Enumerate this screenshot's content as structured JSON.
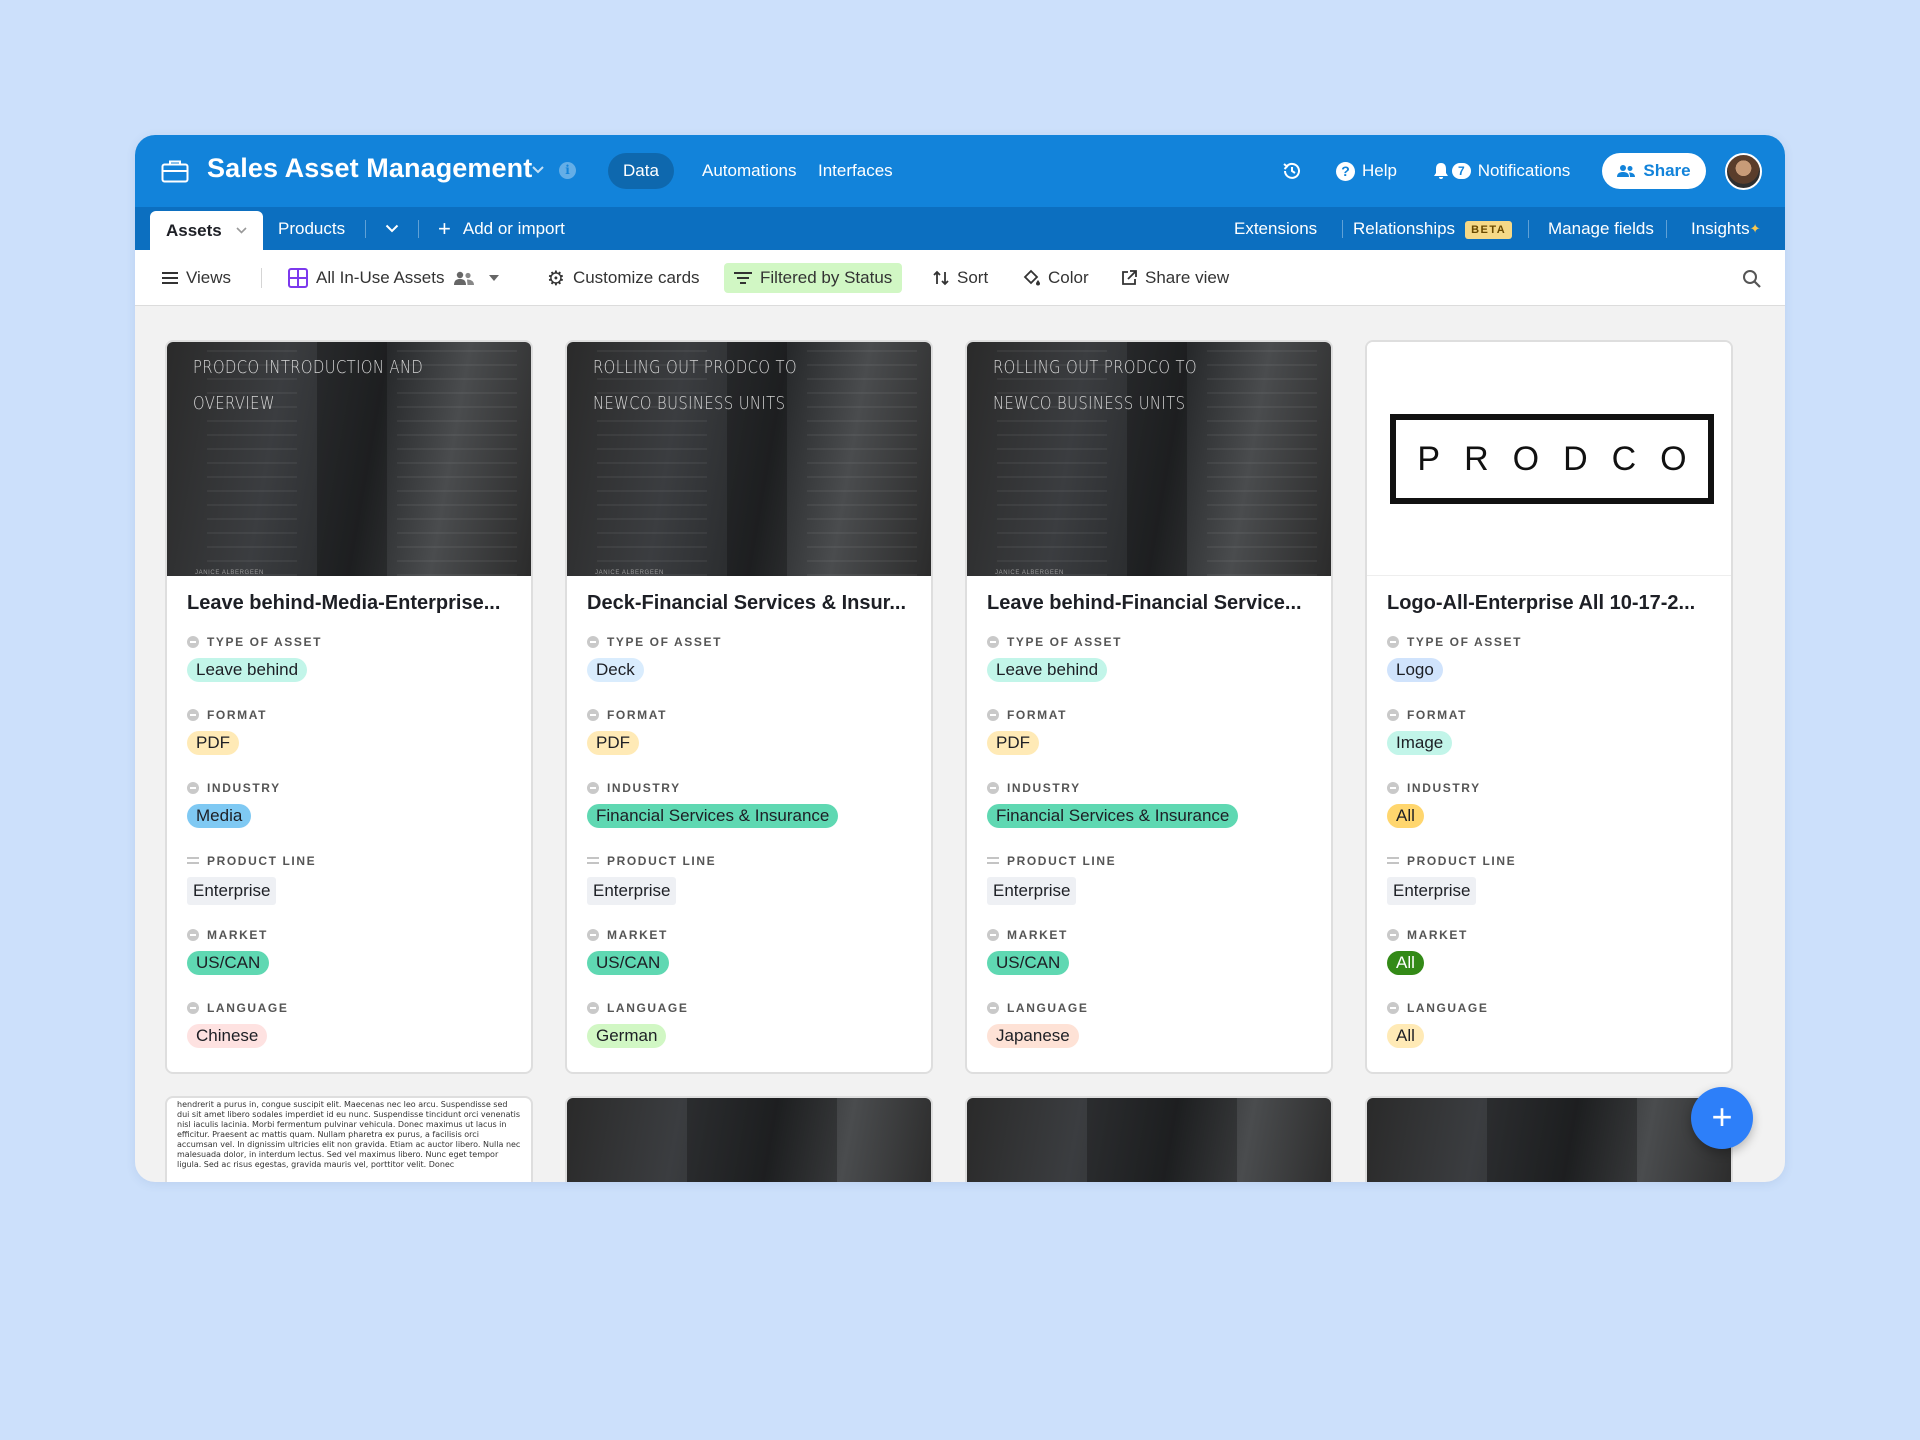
{
  "app": {
    "title": "Sales Asset Management"
  },
  "top_nav": {
    "tabs": [
      "Data",
      "Automations",
      "Interfaces"
    ],
    "active_tab": "Data"
  },
  "top_right": {
    "help": "Help",
    "notifications": "Notifications",
    "notification_count": "7",
    "share": "Share"
  },
  "table_tabs": {
    "assets": "Assets",
    "products": "Products",
    "add": "Add or import"
  },
  "table_right": {
    "extensions": "Extensions",
    "relationships": "Relationships",
    "beta": "BETA",
    "manage_fields": "Manage fields",
    "insights": "Insights"
  },
  "viewbar": {
    "views": "Views",
    "view_name": "All In-Use Assets",
    "customize": "Customize cards",
    "filter": "Filtered by Status",
    "sort": "Sort",
    "color": "Color",
    "share_view": "Share view"
  },
  "field_labels": {
    "type": "TYPE OF ASSET",
    "format": "FORMAT",
    "industry": "INDUSTRY",
    "product_line": "PRODUCT LINE",
    "market": "MARKET",
    "language": "LANGUAGE"
  },
  "cards": [
    {
      "slide": [
        "PRODCO INTRODUCTION AND",
        "OVERVIEW"
      ],
      "author": "JANICE ALBERGEEN",
      "title": "Leave behind-Media-Enterprise...",
      "type": "Leave behind",
      "format": "PDF",
      "industry": "Media",
      "product_line": "Enterprise",
      "market": "US/CAN",
      "language": "Chinese",
      "colors": {
        "type": "#c2f5e9",
        "format": "#ffeab6",
        "industry": "#7fc9f3",
        "market": "#5fd8b2",
        "language": "#fee2e1"
      }
    },
    {
      "slide": [
        "ROLLING OUT PRODCO TO",
        "NEWCO BUSINESS UNITS"
      ],
      "author": "JANICE ALBERGEEN",
      "title": "Deck-Financial Services & Insur...",
      "type": "Deck",
      "format": "PDF",
      "industry": "Financial Services & Insurance",
      "product_line": "Enterprise",
      "market": "US/CAN",
      "language": "German",
      "colors": {
        "type": "#d9ecfd",
        "format": "#ffeab6",
        "industry": "#5fd8b2",
        "market": "#5fd8b2",
        "language": "#d1f7c4"
      }
    },
    {
      "slide": [
        "ROLLING OUT PRODCO TO",
        "NEWCO BUSINESS UNITS"
      ],
      "author": "JANICE ALBERGEEN",
      "title": "Leave behind-Financial Service...",
      "type": "Leave behind",
      "format": "PDF",
      "industry": "Financial Services & Insurance",
      "product_line": "Enterprise",
      "market": "US/CAN",
      "language": "Japanese",
      "colors": {
        "type": "#c2f5e9",
        "format": "#ffeab6",
        "industry": "#5fd8b2",
        "market": "#5fd8b2",
        "language": "#fee2d6"
      }
    },
    {
      "logo": "PRODCO",
      "title": "Logo-All-Enterprise All 10-17-2...",
      "type": "Logo",
      "format": "Image",
      "industry": "All",
      "product_line": "Enterprise",
      "market": "All",
      "language": "All",
      "colors": {
        "type": "#d0e3fc",
        "format": "#c2f5e9",
        "industry": "#ffd66e",
        "market": "#338a17",
        "language": "#ffeab6"
      }
    }
  ],
  "doc_preview": "hendrerit a purus in, congue suscipit elit. Maecenas nec leo arcu. Suspendisse sed dui sit amet libero sodales imperdiet id eu nunc. Suspendisse tincidunt orci venenatis nisl iaculis lacinia. Morbi fermentum pulvinar vehicula. Donec maximus ut lacus in efficitur. Praesent ac mattis quam. Nullam pharetra ex purus, a facilisis orci accumsan vel. In dignissim ultricies elit non gravida. Etiam ac auctor libero. Nulla nec malesuada dolor, in interdum lectus. Sed vel maximus libero. Nunc eget tempor ligula. Sed ac risus egestas, gravida mauris vel, porttitor velit. Donec",
  "fab": "+"
}
